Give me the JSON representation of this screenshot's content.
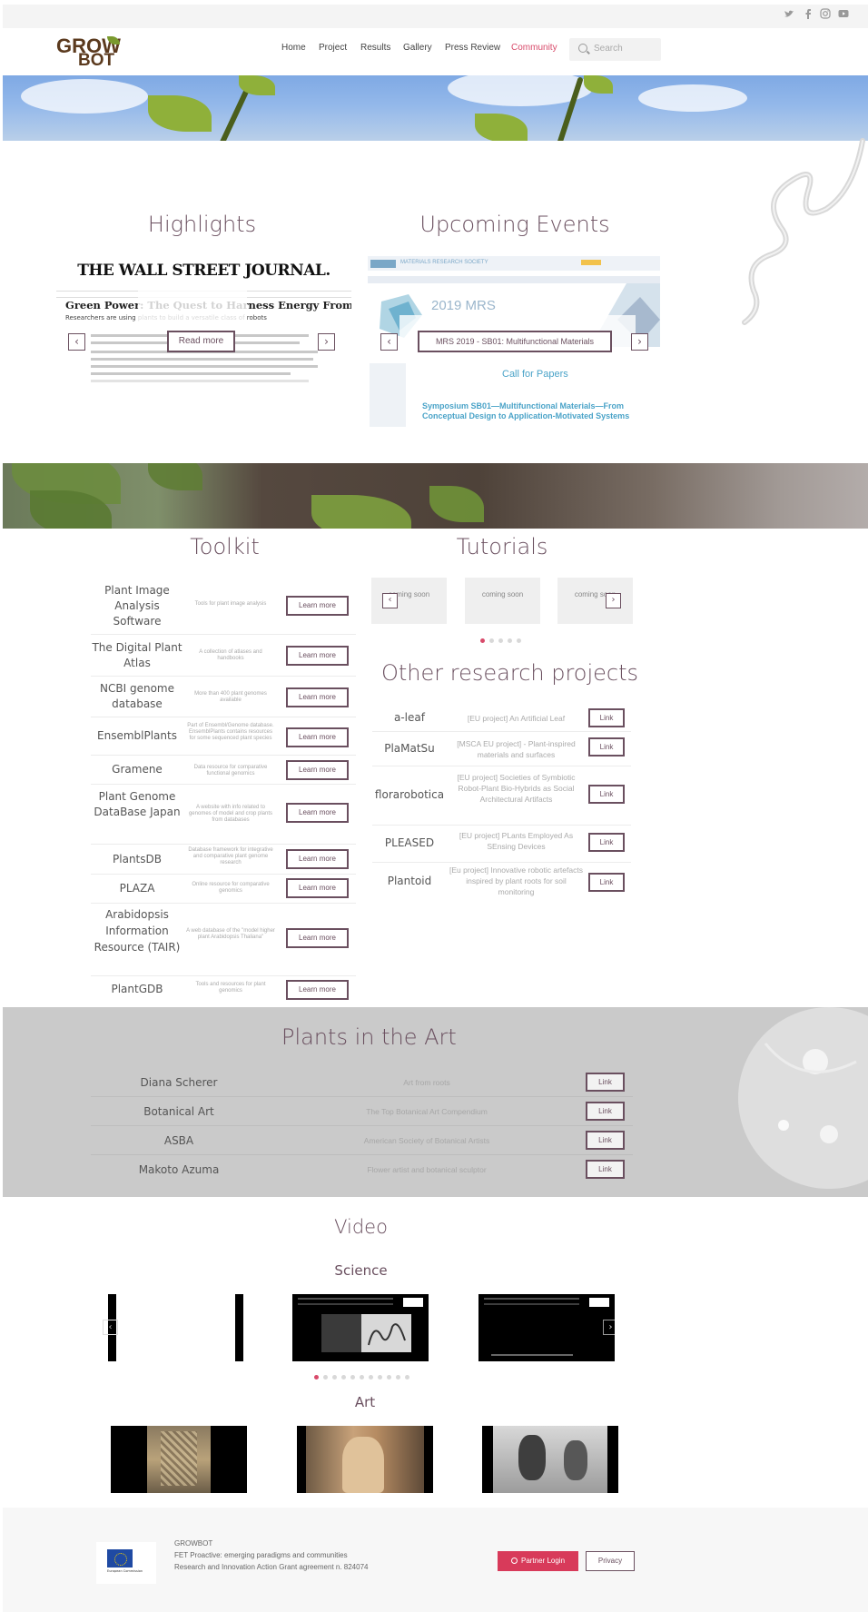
{
  "top_bar": {
    "social_icons": [
      "twitter-icon",
      "facebook-icon",
      "instagram-icon",
      "youtube-icon"
    ]
  },
  "header": {
    "logo_line1": "GROW",
    "logo_line2": "BOT",
    "nav": [
      {
        "label": "Home"
      },
      {
        "label": "Project"
      },
      {
        "label": "Results"
      },
      {
        "label": "Gallery"
      },
      {
        "label": "Press Review"
      },
      {
        "label": "Community",
        "active": true
      }
    ],
    "search_placeholder": "Search"
  },
  "highlights": {
    "title": "Highlights",
    "slide": {
      "masthead": "THE WALL STREET JOURNAL.",
      "headline": "Green Power: The Quest to Harness Energy From Leaves",
      "dek": "Researchers are using plants to build a versatile class of robots"
    },
    "button": "Read more"
  },
  "events": {
    "title": "Upcoming Events",
    "slide": {
      "org": "MATERIALS RESEARCH SOCIETY",
      "banner": "2019 MRS",
      "cfp": "Call for Papers",
      "symposium_line1": "Symposium SB01—Multifunctional Materials—From",
      "symposium_line2": "Conceptual Design to Application-Motivated Systems"
    },
    "button": "MRS 2019 - SB01: Multifunctional Materials"
  },
  "toolkit": {
    "title": "Toolkit",
    "button_label": "Learn more",
    "items": [
      {
        "name": "Plant Image Analysis Software",
        "desc": "Tools for plant image analysis"
      },
      {
        "name": "The Digital Plant Atlas",
        "desc": "A collection of atlases and handbooks"
      },
      {
        "name": "NCBI genome database",
        "desc": "More than 400 plant genomes available"
      },
      {
        "name": "EnsemblPlants",
        "desc": "Part of Ensembl/Genome database. EnsemblPlants contains resources for some sequenced plant species"
      },
      {
        "name": "Gramene",
        "desc": "Data resource for comparative functional genomics"
      },
      {
        "name": "Plant Genome DataBase Japan",
        "desc": "A website with info related to genomes of model and crop plants from databases"
      },
      {
        "name": "PlantsDB",
        "desc": "Database framework for integrative and comparative plant genome research"
      },
      {
        "name": "PLAZA",
        "desc": "Online resource for comparative genomics"
      },
      {
        "name": "Arabidopsis Information Resource (TAIR)",
        "desc": "A web database of the \"model higher plant Arabidopsis Thaliana\""
      },
      {
        "name": "PlantGDB",
        "desc": "Tools and resources for plant genomics"
      }
    ]
  },
  "tutorials": {
    "title": "Tutorials",
    "cards": [
      "coming soon",
      "coming soon",
      "coming soon"
    ]
  },
  "other_research": {
    "title": "Other research projects",
    "button_label": "Link",
    "items": [
      {
        "name": "a-leaf",
        "desc": "[EU project] An Artificial Leaf"
      },
      {
        "name": "PlaMatSu",
        "desc": "[MSCA EU project] - Plant-inspired materials and surfaces"
      },
      {
        "name": "florarobotica",
        "desc": "[EU project] Societies of Symbiotic Robot-Plant Bio-Hybrids as Social Architectural Artifacts"
      },
      {
        "name": "PLEASED",
        "desc": "[EU project] PLants Employed As SEnsing Devices"
      },
      {
        "name": "Plantoid",
        "desc": "[Eu project] Innovative robotic artefacts inspired by plant roots for soil monitoring"
      }
    ]
  },
  "plants_art": {
    "title": "Plants in the Art",
    "button_label": "Link",
    "items": [
      {
        "name": "Diana Scherer",
        "desc": "Art from roots"
      },
      {
        "name": "Botanical Art",
        "desc": "The Top Botanical Art Compendium"
      },
      {
        "name": "ASBA",
        "desc": "American Society of Botanical Artists"
      },
      {
        "name": "Makoto Azuma",
        "desc": "Flower artist and botanical sculptor"
      }
    ]
  },
  "video": {
    "title": "Video",
    "science_label": "Science",
    "art_label": "Art"
  },
  "footer": {
    "eu_text": "European Commission",
    "line1": "GROWBOT",
    "line2": "FET Proactive: emerging paradigms and communities",
    "line3": "Research and Innovation Action Grant agreement n. 824074",
    "login": "Partner Login",
    "privacy": "Privacy"
  },
  "colors": {
    "accent": "#6a4f5f",
    "active_nav": "#d84a6a",
    "login_button": "#d83a5a"
  }
}
